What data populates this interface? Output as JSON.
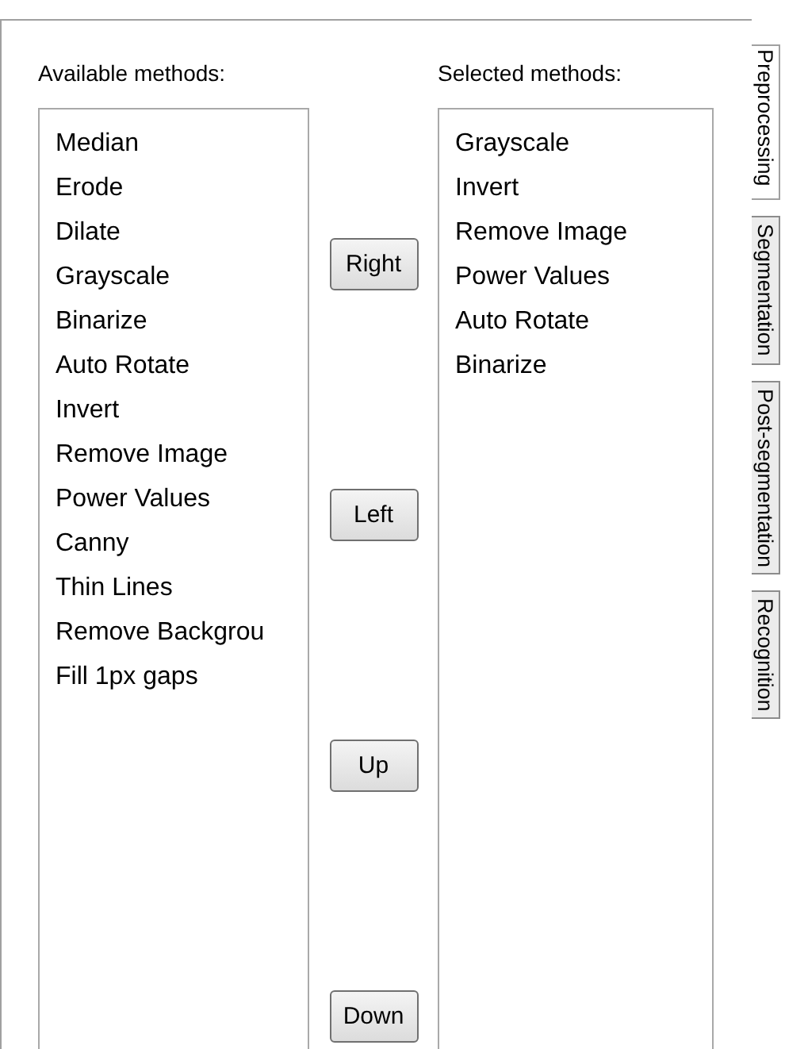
{
  "available": {
    "label": "Available methods:",
    "items": [
      "Median",
      "Erode",
      "Dilate",
      "Grayscale",
      "Binarize",
      "Auto Rotate",
      "Invert",
      "Remove Image",
      "Power Values",
      "Canny",
      "Thin Lines",
      "Remove Backgrou",
      "Fill 1px gaps"
    ]
  },
  "buttons": [
    "Right",
    "Left",
    "Up",
    "Down"
  ],
  "selected": {
    "label": "Selected methods:",
    "items": [
      "Grayscale",
      "Invert",
      "Remove Image",
      "Power Values",
      "Auto Rotate",
      "Binarize"
    ]
  },
  "tabs": [
    {
      "label": "Preprocessing",
      "selected": true
    },
    {
      "label": "Segmentation",
      "selected": false
    },
    {
      "label": "Post-segmentation",
      "selected": false
    },
    {
      "label": "Recognition",
      "selected": false
    }
  ]
}
